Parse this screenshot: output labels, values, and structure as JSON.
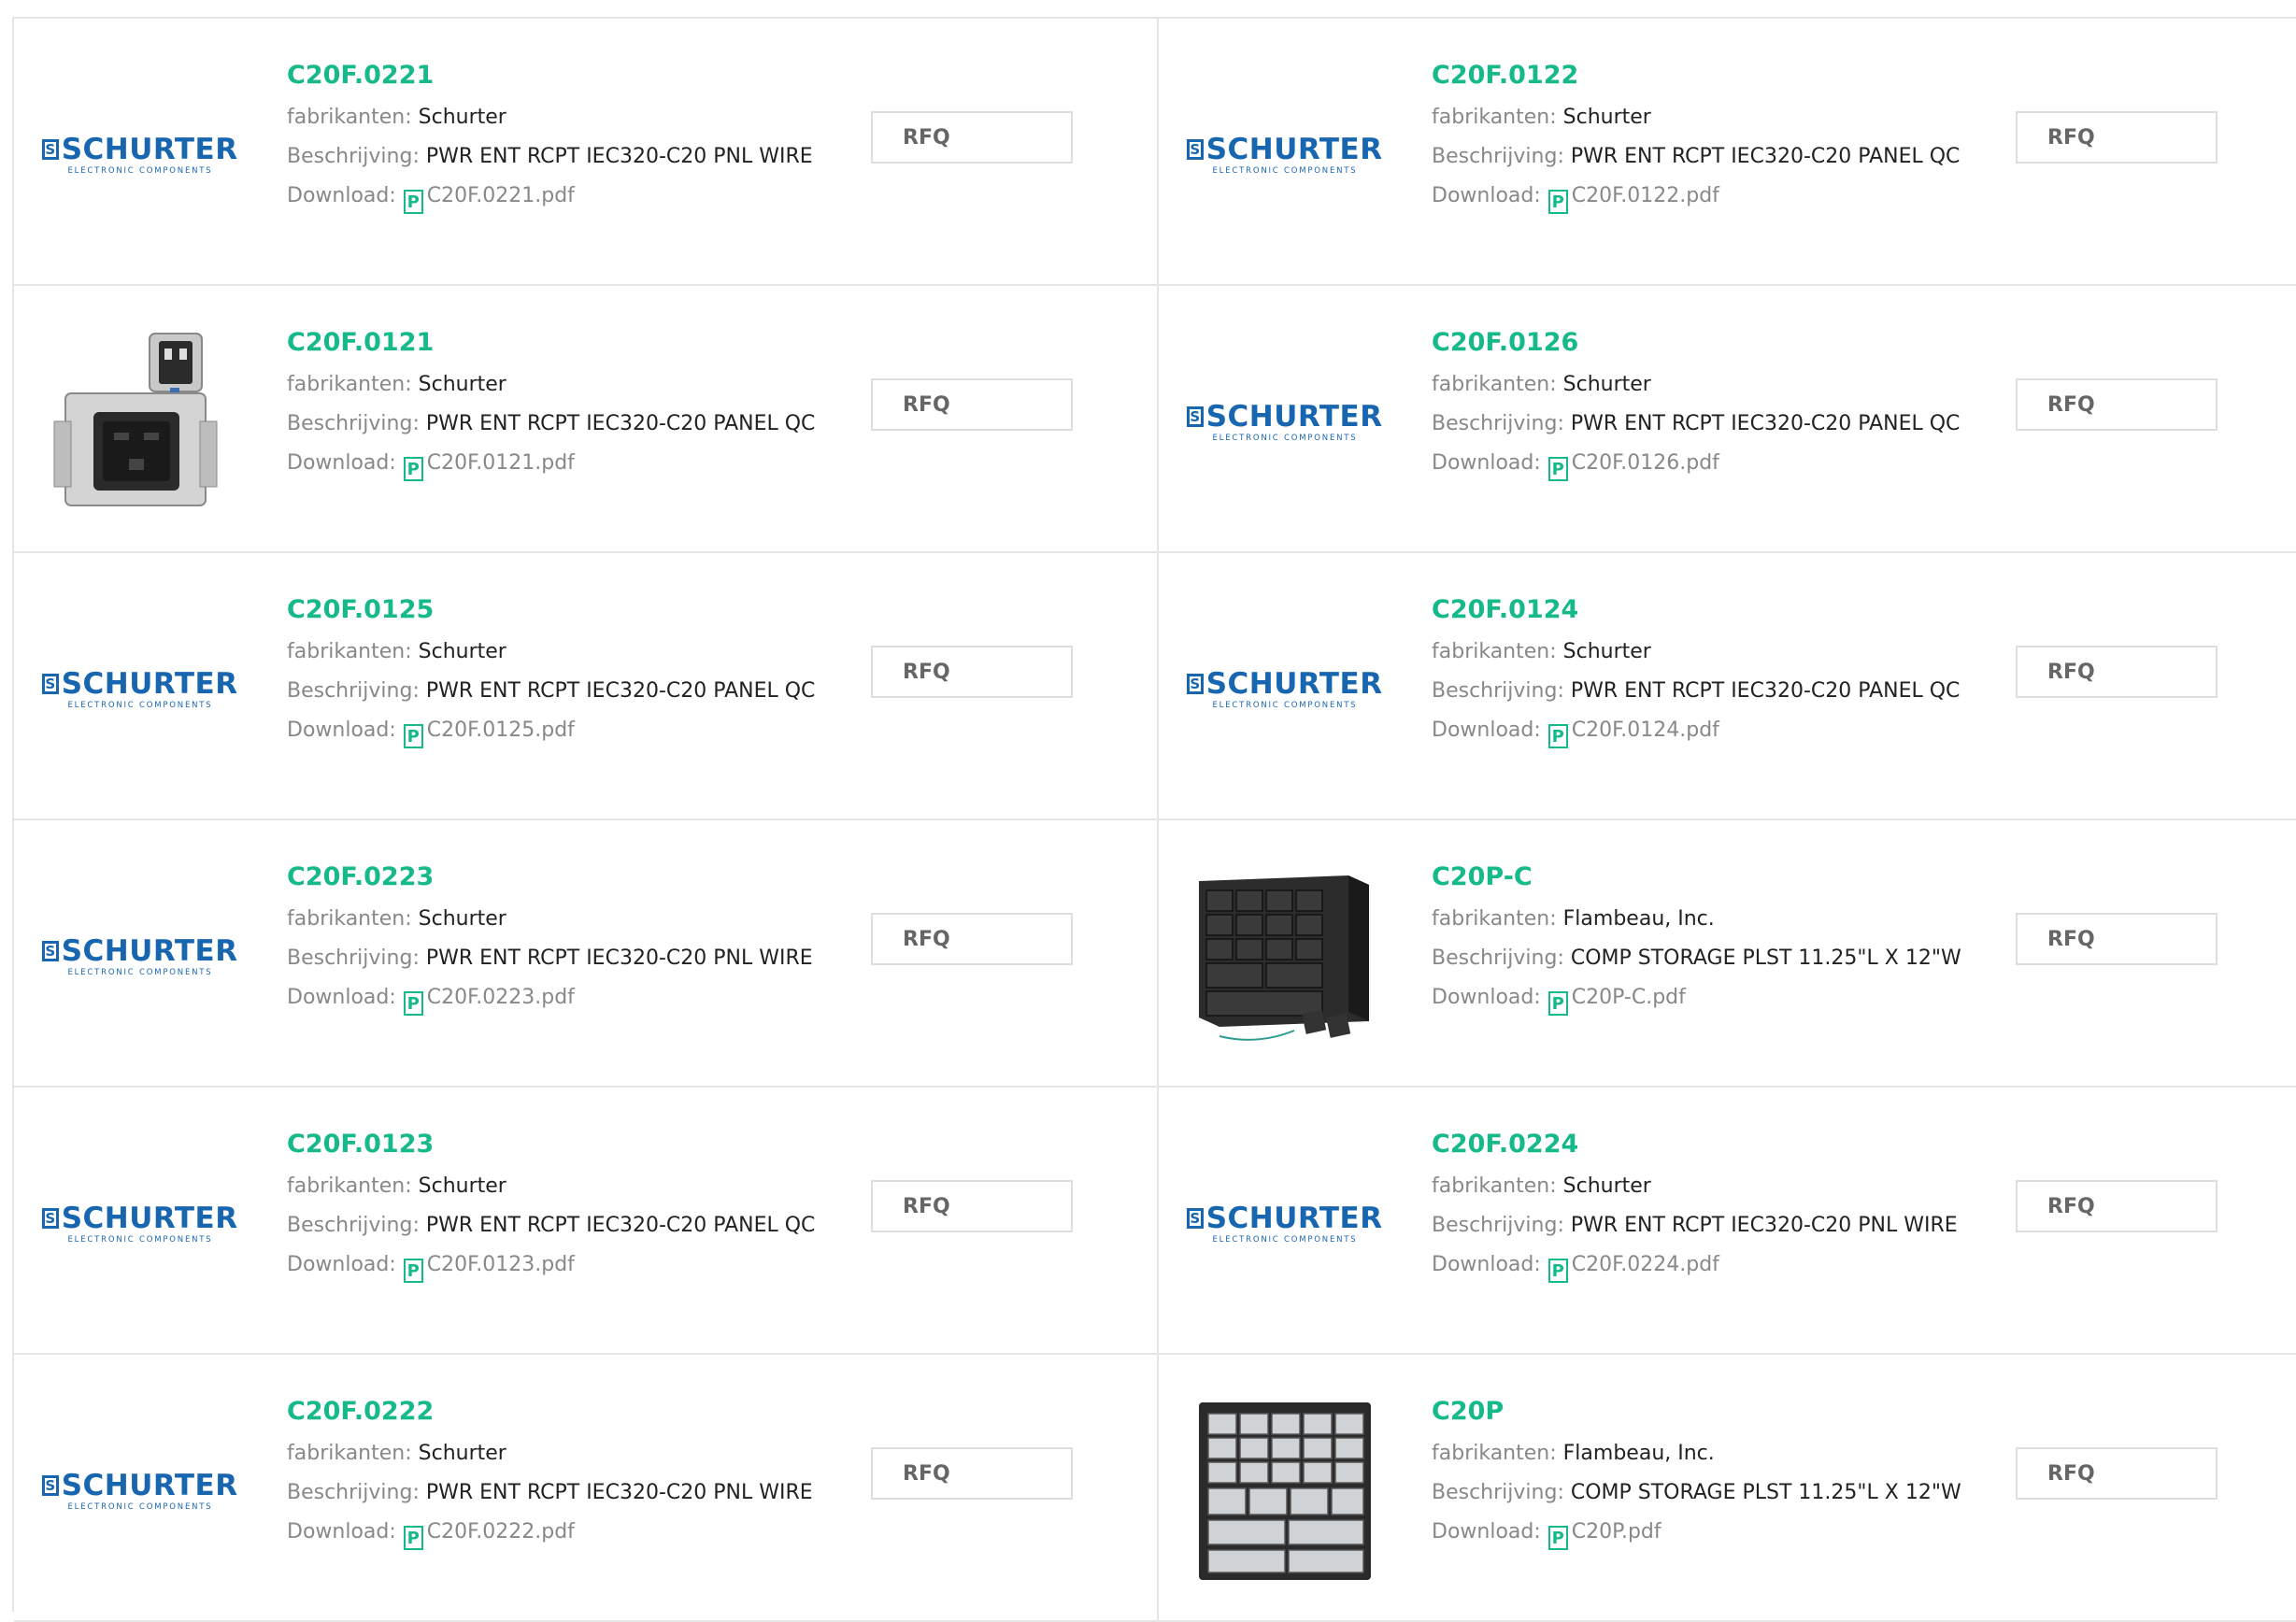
{
  "labels": {
    "manufacturer": "fabrikanten:",
    "description": "Beschrijving:",
    "download": "Download:",
    "rfq": "RFQ",
    "pdf_glyph": "P"
  },
  "logo": {
    "mark": "S",
    "name": "SCHURTER",
    "tagline": "ELECTRONIC COMPONENTS",
    "color": "#1866b0"
  },
  "accent_color": "#15b98a",
  "products": [
    {
      "part": "C20F.0221",
      "manufacturer": "Schurter",
      "description": "PWR ENT RCPT IEC320-C20 PNL WIRE",
      "file": "C20F.0221.pdf",
      "image": "schurter-logo"
    },
    {
      "part": "C20F.0122",
      "manufacturer": "Schurter",
      "description": "PWR ENT RCPT IEC320-C20 PANEL QC",
      "file": "C20F.0122.pdf",
      "image": "schurter-logo"
    },
    {
      "part": "C20F.0121",
      "manufacturer": "Schurter",
      "description": "PWR ENT RCPT IEC320-C20 PANEL QC",
      "file": "C20F.0121.pdf",
      "image": "connector-photo"
    },
    {
      "part": "C20F.0126",
      "manufacturer": "Schurter",
      "description": "PWR ENT RCPT IEC320-C20 PANEL QC",
      "file": "C20F.0126.pdf",
      "image": "schurter-logo"
    },
    {
      "part": "C20F.0125",
      "manufacturer": "Schurter",
      "description": "PWR ENT RCPT IEC320-C20 PANEL QC",
      "file": "C20F.0125.pdf",
      "image": "schurter-logo"
    },
    {
      "part": "C20F.0124",
      "manufacturer": "Schurter",
      "description": "PWR ENT RCPT IEC320-C20 PANEL QC",
      "file": "C20F.0124.pdf",
      "image": "schurter-logo"
    },
    {
      "part": "C20F.0223",
      "manufacturer": "Schurter",
      "description": "PWR ENT RCPT IEC320-C20 PNL WIRE",
      "file": "C20F.0223.pdf",
      "image": "schurter-logo"
    },
    {
      "part": "C20P-C",
      "manufacturer": "Flambeau, Inc.",
      "description": "COMP STORAGE PLST 11.25\"L X 12\"W",
      "file": "C20P-C.pdf",
      "image": "storage-cabinet-photo"
    },
    {
      "part": "C20F.0123",
      "manufacturer": "Schurter",
      "description": "PWR ENT RCPT IEC320-C20 PANEL QC",
      "file": "C20F.0123.pdf",
      "image": "schurter-logo"
    },
    {
      "part": "C20F.0224",
      "manufacturer": "Schurter",
      "description": "PWR ENT RCPT IEC320-C20 PNL WIRE",
      "file": "C20F.0224.pdf",
      "image": "schurter-logo"
    },
    {
      "part": "C20F.0222",
      "manufacturer": "Schurter",
      "description": "PWR ENT RCPT IEC320-C20 PNL WIRE",
      "file": "C20F.0222.pdf",
      "image": "schurter-logo"
    },
    {
      "part": "C20P",
      "manufacturer": "Flambeau, Inc.",
      "description": "COMP STORAGE PLST 11.25\"L X 12\"W",
      "file": "C20P.pdf",
      "image": "drawer-cabinet-photo"
    }
  ]
}
